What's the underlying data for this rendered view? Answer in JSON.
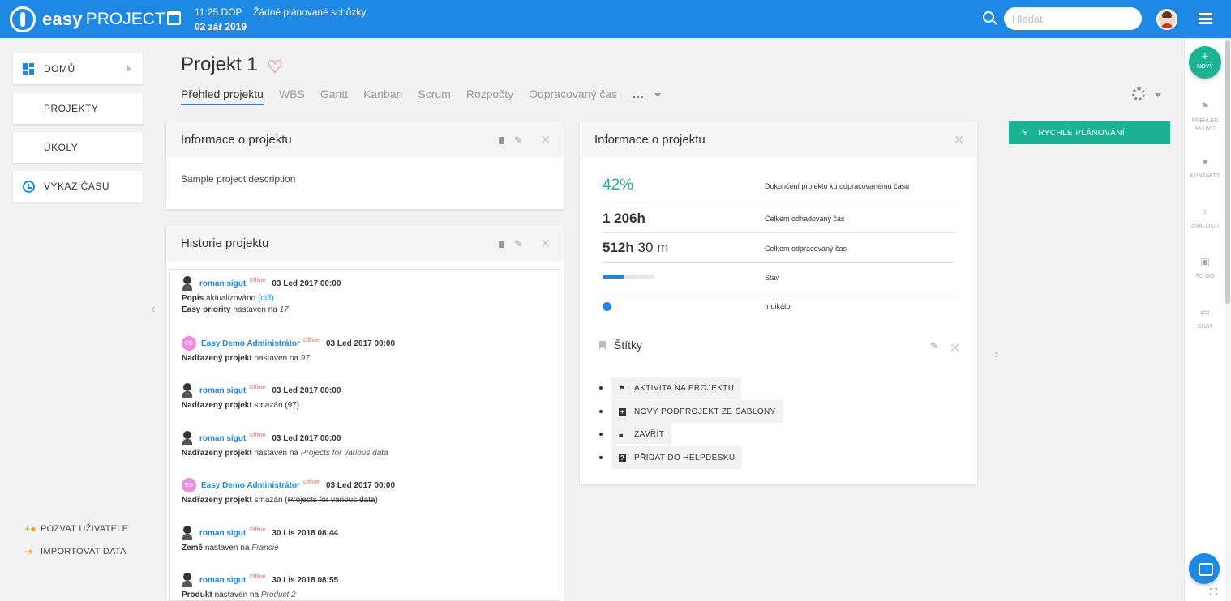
{
  "topbar": {
    "logo_easy": "easy",
    "logo_project": "PROJECT",
    "time": "11:25 DOP.",
    "meeting": "Žádné plánované schůzky",
    "date": "02 zář 2019",
    "search_placeholder": "Hledat"
  },
  "left_nav": {
    "items": [
      {
        "label": "DOMŮ"
      },
      {
        "label": "PROJEKTY"
      },
      {
        "label": "ÚKOLY"
      },
      {
        "label": "VÝKAZ ČASU"
      }
    ],
    "bottom_links": [
      {
        "label": "POZVAT UŽIVATELE"
      },
      {
        "label": "IMPORTOVAT DATA"
      }
    ]
  },
  "page": {
    "title": "Projekt 1",
    "tabs": [
      "Přehled projektu",
      "WBS",
      "Gantt",
      "Kanban",
      "Scrum",
      "Rozpočty",
      "Odpracovaný čas"
    ],
    "tabs_more": "..."
  },
  "info_panel": {
    "title": "Informace o projektu",
    "description": "Sample project description"
  },
  "history_panel": {
    "title": "Historie projektu",
    "offline_label": "Offline",
    "entries": [
      {
        "user": "roman sigut",
        "date": "03 Led 2017 00:00",
        "line1_field": "Popis",
        "line1_text": "aktualizováno",
        "line1_link": "(diff)",
        "line2_field": "Easy priority",
        "line2_text": "nastaven na",
        "line2_value": "17"
      },
      {
        "user": "Easy Demo Administrátor",
        "initials": "ED",
        "date": "03 Led 2017 00:00",
        "field": "Nadřazený projekt",
        "text": "nastaven na",
        "value": "97"
      },
      {
        "user": "roman sigut",
        "date": "03 Led 2017 00:00",
        "field": "Nadřazený projekt",
        "text": "smazán (97)"
      },
      {
        "user": "roman sigut",
        "date": "03 Led 2017 00:00",
        "field": "Nadřazený projekt",
        "text": "nastaven na",
        "value": "Projects for various data"
      },
      {
        "user": "Easy Demo Administrátor",
        "initials": "ED",
        "date": "03 Led 2017 00:00",
        "field": "Nadřazený projekt",
        "text": "smazán (",
        "struck": "Projects for various data",
        "text_end": ")"
      },
      {
        "user": "roman sigut",
        "date": "30 Lis 2018 08:44",
        "field": "Země",
        "text": "nastaven na",
        "value": "Francie"
      },
      {
        "user": "roman sigut",
        "date": "30 Lis 2018 08:55",
        "field": "Produkt",
        "text": "nastaven na",
        "value": "Product 2"
      }
    ]
  },
  "stats_panel": {
    "title": "Informace o projektu",
    "completion_pct": "42%",
    "completion_label": "Dokončení projektu ku odpracovanému času",
    "estimated_value": "1 206h",
    "estimated_label": "Celkem odhadovaný čas",
    "spent_hours": "512h",
    "spent_minutes": "30 m",
    "spent_label": "Celkem odpracovaný čas",
    "status_label": "Stav",
    "status_progress": 0.42,
    "indicator_label": "Indikátor",
    "tags_title": "Štítky",
    "actions": [
      {
        "label": "AKTIVITA NA PROJEKTU",
        "icon": "flag-icon"
      },
      {
        "label": "NOVÝ PODPROJEKT ZE ŠABLONY",
        "icon": "plus-square-icon"
      },
      {
        "label": "ZAVŘÍT",
        "icon": "lock-icon"
      },
      {
        "label": "PŘIDAT DO HELPDESKU",
        "icon": "question-square-icon"
      }
    ]
  },
  "quick_planning": {
    "label": "RYCHLÉ PLÁNOVÁNÍ"
  },
  "right_sidebar": {
    "new_label": "NOVÝ",
    "items": [
      {
        "label1": "PŘEHLED",
        "label2": "AKTIVIT",
        "icon": "flag-icon"
      },
      {
        "label1": "KONTAKTY",
        "label2": "",
        "icon": "person-icon"
      },
      {
        "label1": "ZNALOSTI",
        "label2": "",
        "icon": "bulb-icon"
      },
      {
        "label1": "TO-DO",
        "label2": "",
        "icon": "clipboard-icon"
      },
      {
        "label1": "CHAT",
        "label2": "",
        "icon": "chat-icon"
      }
    ]
  },
  "colors": {
    "brand_blue": "#1e88e5",
    "accent_green": "#1ab394",
    "heart_pink": "#e84b6f",
    "offline_red": "#e57373"
  }
}
